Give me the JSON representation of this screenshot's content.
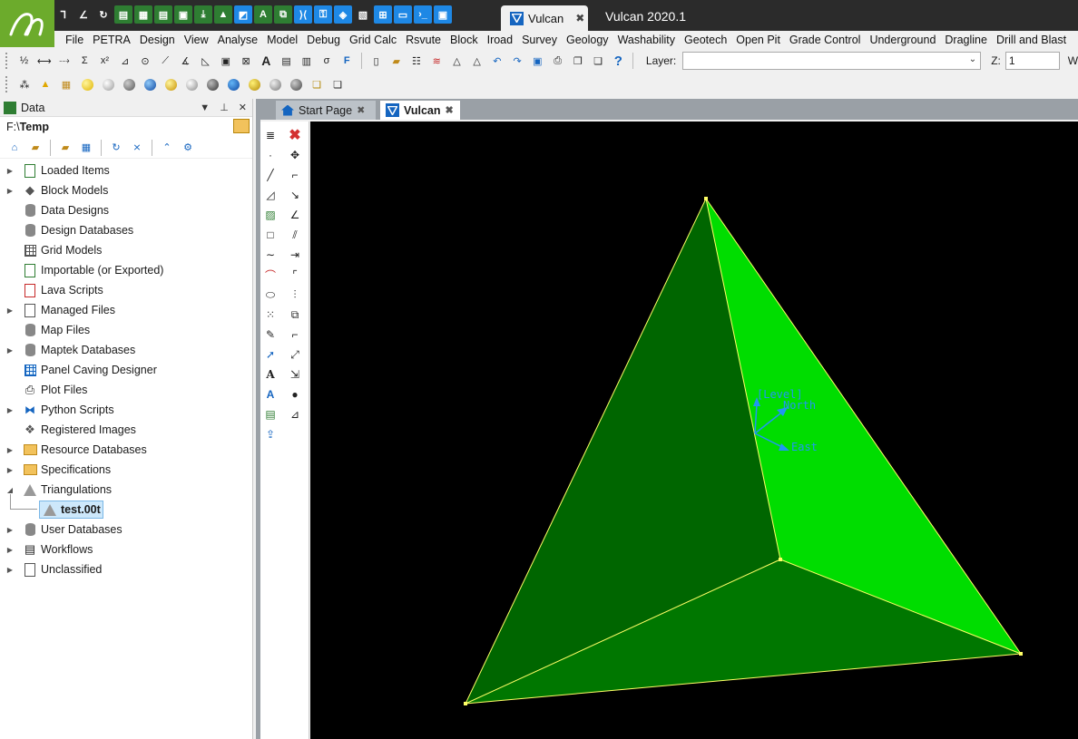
{
  "app": {
    "tab_label": "Vulcan",
    "title": "Vulcan 2020.1"
  },
  "menu": [
    "File",
    "PETRA",
    "Design",
    "View",
    "Analyse",
    "Model",
    "Debug",
    "Grid Calc",
    "Rsvute",
    "Block",
    "Iroad",
    "Survey",
    "Geology",
    "Washability",
    "Geotech",
    "Open Pit",
    "Grade Control",
    "Underground",
    "Dragline",
    "Drill and Blast"
  ],
  "toolbar": {
    "layer_label": "Layer:",
    "layer_value": "",
    "z_label": "Z:",
    "z_value": "1",
    "w_label": "W"
  },
  "panel": {
    "title": "Data",
    "path_prefix": "F:\\",
    "path_folder": "Temp",
    "tree": [
      {
        "label": "Loaded Items",
        "icon": "loaded-items-icon",
        "expandable": true
      },
      {
        "label": "Block Models",
        "icon": "block-models-icon",
        "expandable": true
      },
      {
        "label": "Data Designs",
        "icon": "database-icon",
        "expandable": false
      },
      {
        "label": "Design Databases",
        "icon": "database-icon",
        "expandable": false
      },
      {
        "label": "Grid Models",
        "icon": "grid-icon",
        "expandable": false
      },
      {
        "label": "Importable (or Exported)",
        "icon": "import-icon",
        "expandable": false
      },
      {
        "label": "Lava Scripts",
        "icon": "script-icon",
        "expandable": false
      },
      {
        "label": "Managed Files",
        "icon": "file-icon",
        "expandable": true
      },
      {
        "label": "Map Files",
        "icon": "database-icon",
        "expandable": false
      },
      {
        "label": "Maptek Databases",
        "icon": "database-icon",
        "expandable": true
      },
      {
        "label": "Panel Caving Designer",
        "icon": "grid-blue-icon",
        "expandable": false
      },
      {
        "label": "Plot Files",
        "icon": "plot-icon",
        "expandable": false
      },
      {
        "label": "Python Scripts",
        "icon": "python-icon",
        "expandable": true
      },
      {
        "label": "Registered Images",
        "icon": "images-icon",
        "expandable": false
      },
      {
        "label": "Resource Databases",
        "icon": "folder-icon",
        "expandable": true
      },
      {
        "label": "Specifications",
        "icon": "folder-icon",
        "expandable": true
      },
      {
        "label": "Triangulations",
        "icon": "triangle-icon",
        "expandable": true,
        "expanded": true
      },
      {
        "label": "test.00t",
        "icon": "triangle-icon",
        "child": true,
        "selected": true
      },
      {
        "label": "User Databases",
        "icon": "database-icon",
        "expandable": true
      },
      {
        "label": "Workflows",
        "icon": "workflow-icon",
        "expandable": true
      },
      {
        "label": "Unclassified",
        "icon": "file-icon",
        "expandable": true
      }
    ]
  },
  "doc_tabs": {
    "start_page": "Start Page",
    "vulcan": "Vulcan"
  },
  "viewport": {
    "background": "#000000",
    "face_light": "#00dd00",
    "face_dark": "#006600",
    "face_mid": "#007700",
    "edge_color": "#ffff66",
    "axis_color": "#2196f3",
    "axis_labels": {
      "level": "[Level]",
      "north": "North",
      "east": "East"
    }
  }
}
